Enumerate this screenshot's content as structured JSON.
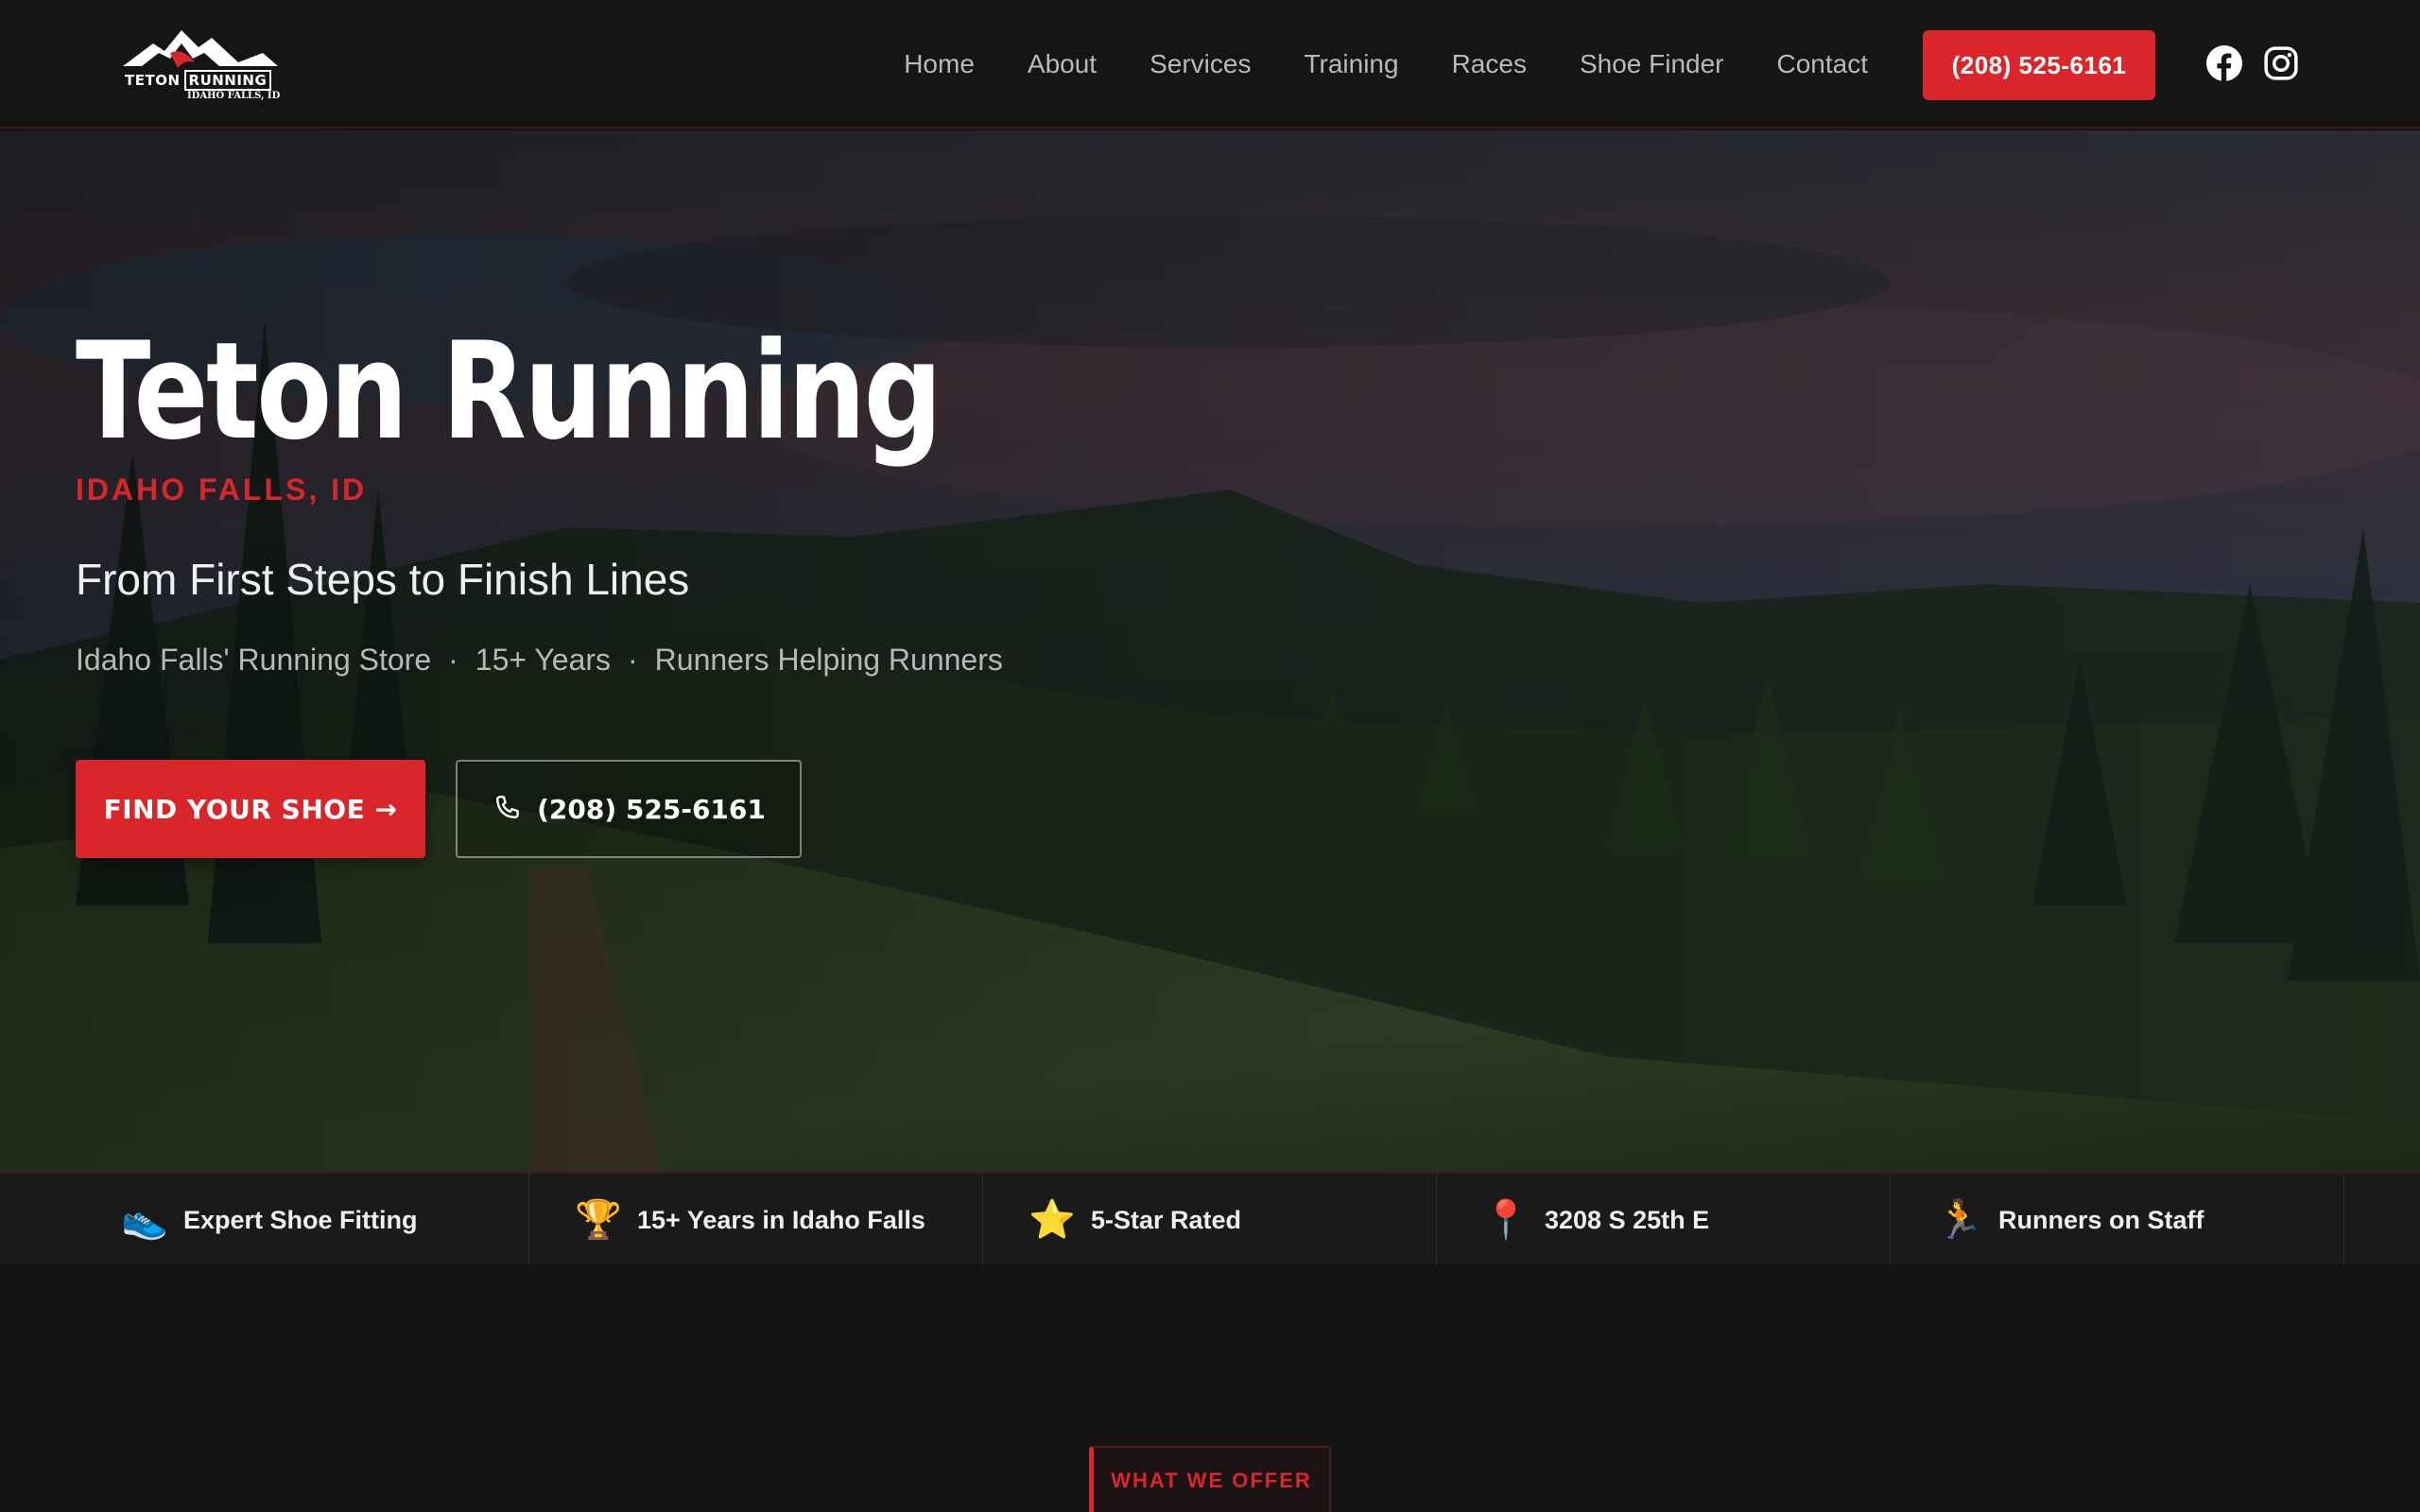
{
  "brand": {
    "logo_main": "TETON",
    "logo_run": "RUNNING",
    "logo_sub": "IDAHO FALLS, ID"
  },
  "nav": {
    "links": [
      "Home",
      "About",
      "Services",
      "Training",
      "Races",
      "Shoe Finder",
      "Contact"
    ],
    "phone_cta": "(208) 525-6161",
    "social": [
      "facebook-icon",
      "instagram-icon"
    ]
  },
  "hero": {
    "title": "Teton Running",
    "subtitle": "IDAHO FALLS, ID",
    "tagline": "From First Steps to Finish Lines",
    "facts": [
      "Idaho Falls' Running Store",
      "15+ Years",
      "Runners Helping Runners"
    ],
    "separator": "·",
    "primary_button": "FIND YOUR SHOE →",
    "secondary_button": "(208) 525-6161"
  },
  "features": [
    {
      "icon": "👟",
      "icon_name": "shoe-icon",
      "label": "Expert Shoe Fitting"
    },
    {
      "icon": "🏆",
      "icon_name": "trophy-icon",
      "label": "15+ Years in Idaho Falls"
    },
    {
      "icon": "⭐",
      "icon_name": "star-icon",
      "label": "5-Star Rated"
    },
    {
      "icon": "📍",
      "icon_name": "pin-icon",
      "label": "3208 S 25th E"
    },
    {
      "icon": "🏃",
      "icon_name": "runner-icon",
      "label": "Runners on Staff"
    }
  ],
  "section": {
    "badge": "WHAT WE OFFER"
  },
  "colors": {
    "accent": "#d9262b",
    "background": "#131313",
    "nav": "#151515"
  }
}
